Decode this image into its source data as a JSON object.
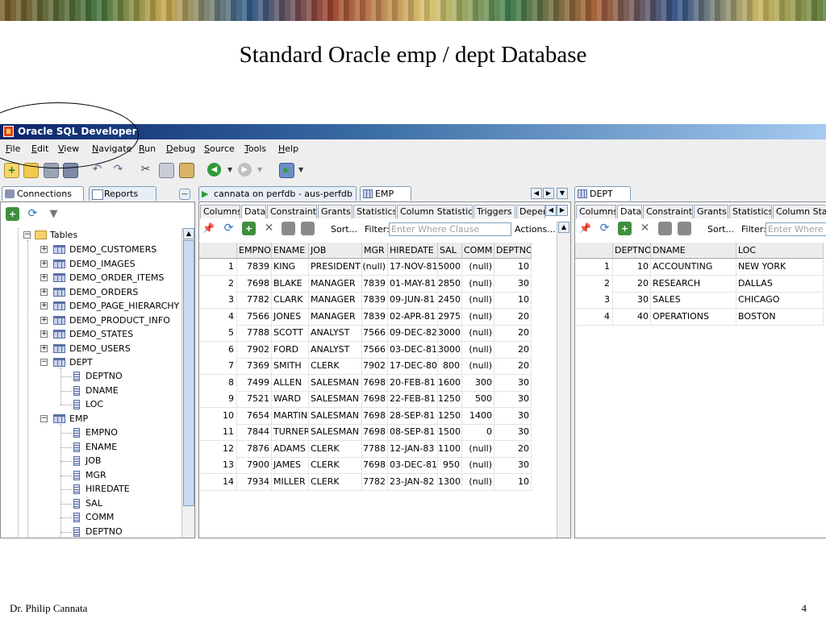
{
  "slide": {
    "title": "Standard Oracle emp / dept Database",
    "footer_left": "Dr. Philip Cannata",
    "page_number": "4"
  },
  "app": {
    "title": "Oracle SQL Developer",
    "menu": [
      "File",
      "Edit",
      "View",
      "Navigate",
      "Run",
      "Debug",
      "Source",
      "Tools",
      "Help"
    ]
  },
  "left_panel": {
    "tabs": [
      "Connections",
      "Reports"
    ],
    "tree": {
      "tables_label": "Tables",
      "items": [
        "DEMO_CUSTOMERS",
        "DEMO_IMAGES",
        "DEMO_ORDER_ITEMS",
        "DEMO_ORDERS",
        "DEMO_PAGE_HIERARCHY",
        "DEMO_PRODUCT_INFO",
        "DEMO_STATES",
        "DEMO_USERS"
      ],
      "dept": {
        "label": "DEPT",
        "columns": [
          "DEPTNO",
          "DNAME",
          "LOC"
        ]
      },
      "emp": {
        "label": "EMP",
        "columns": [
          "EMPNO",
          "ENAME",
          "JOB",
          "MGR",
          "HIREDATE",
          "SAL",
          "COMM",
          "DEPTNO"
        ]
      }
    }
  },
  "emp_panel": {
    "tabs": [
      "cannata on perfdb - aus-perfdb",
      "EMP"
    ],
    "subtabs": [
      "Columns",
      "Data",
      "Constraints",
      "Grants",
      "Statistics",
      "Column Statistics",
      "Triggers",
      "Depen"
    ],
    "sort_label": "Sort...",
    "filter_label": "Filter:",
    "filter_placeholder": "Enter Where Clause",
    "actions_label": "Actions...",
    "columns": [
      "EMPNO",
      "ENAME",
      "JOB",
      "MGR",
      "HIREDATE",
      "SAL",
      "COMM",
      "DEPTNO"
    ],
    "rows": [
      [
        "1",
        "7839",
        "KING",
        "PRESIDENT",
        "(null)",
        "17-NOV-81",
        "5000",
        "(null)",
        "10"
      ],
      [
        "2",
        "7698",
        "BLAKE",
        "MANAGER",
        "7839",
        "01-MAY-81",
        "2850",
        "(null)",
        "30"
      ],
      [
        "3",
        "7782",
        "CLARK",
        "MANAGER",
        "7839",
        "09-JUN-81",
        "2450",
        "(null)",
        "10"
      ],
      [
        "4",
        "7566",
        "JONES",
        "MANAGER",
        "7839",
        "02-APR-81",
        "2975",
        "(null)",
        "20"
      ],
      [
        "5",
        "7788",
        "SCOTT",
        "ANALYST",
        "7566",
        "09-DEC-82",
        "3000",
        "(null)",
        "20"
      ],
      [
        "6",
        "7902",
        "FORD",
        "ANALYST",
        "7566",
        "03-DEC-81",
        "3000",
        "(null)",
        "20"
      ],
      [
        "7",
        "7369",
        "SMITH",
        "CLERK",
        "7902",
        "17-DEC-80",
        "800",
        "(null)",
        "20"
      ],
      [
        "8",
        "7499",
        "ALLEN",
        "SALESMAN",
        "7698",
        "20-FEB-81",
        "1600",
        "300",
        "30"
      ],
      [
        "9",
        "7521",
        "WARD",
        "SALESMAN",
        "7698",
        "22-FEB-81",
        "1250",
        "500",
        "30"
      ],
      [
        "10",
        "7654",
        "MARTIN",
        "SALESMAN",
        "7698",
        "28-SEP-81",
        "1250",
        "1400",
        "30"
      ],
      [
        "11",
        "7844",
        "TURNER",
        "SALESMAN",
        "7698",
        "08-SEP-81",
        "1500",
        "0",
        "30"
      ],
      [
        "12",
        "7876",
        "ADAMS",
        "CLERK",
        "7788",
        "12-JAN-83",
        "1100",
        "(null)",
        "20"
      ],
      [
        "13",
        "7900",
        "JAMES",
        "CLERK",
        "7698",
        "03-DEC-81",
        "950",
        "(null)",
        "30"
      ],
      [
        "14",
        "7934",
        "MILLER",
        "CLERK",
        "7782",
        "23-JAN-82",
        "1300",
        "(null)",
        "10"
      ]
    ]
  },
  "dept_panel": {
    "tabs": [
      "DEPT"
    ],
    "subtabs": [
      "Columns",
      "Data",
      "Constraints",
      "Grants",
      "Statistics",
      "Column Stati"
    ],
    "sort_label": "Sort...",
    "filter_label": "Filter:",
    "filter_placeholder": "Enter Where Cl",
    "columns": [
      "DEPTNO",
      "DNAME",
      "LOC"
    ],
    "rows": [
      [
        "1",
        "10",
        "ACCOUNTING",
        "NEW YORK"
      ],
      [
        "2",
        "20",
        "RESEARCH",
        "DALLAS"
      ],
      [
        "3",
        "30",
        "SALES",
        "CHICAGO"
      ],
      [
        "4",
        "40",
        "OPERATIONS",
        "BOSTON"
      ]
    ]
  }
}
